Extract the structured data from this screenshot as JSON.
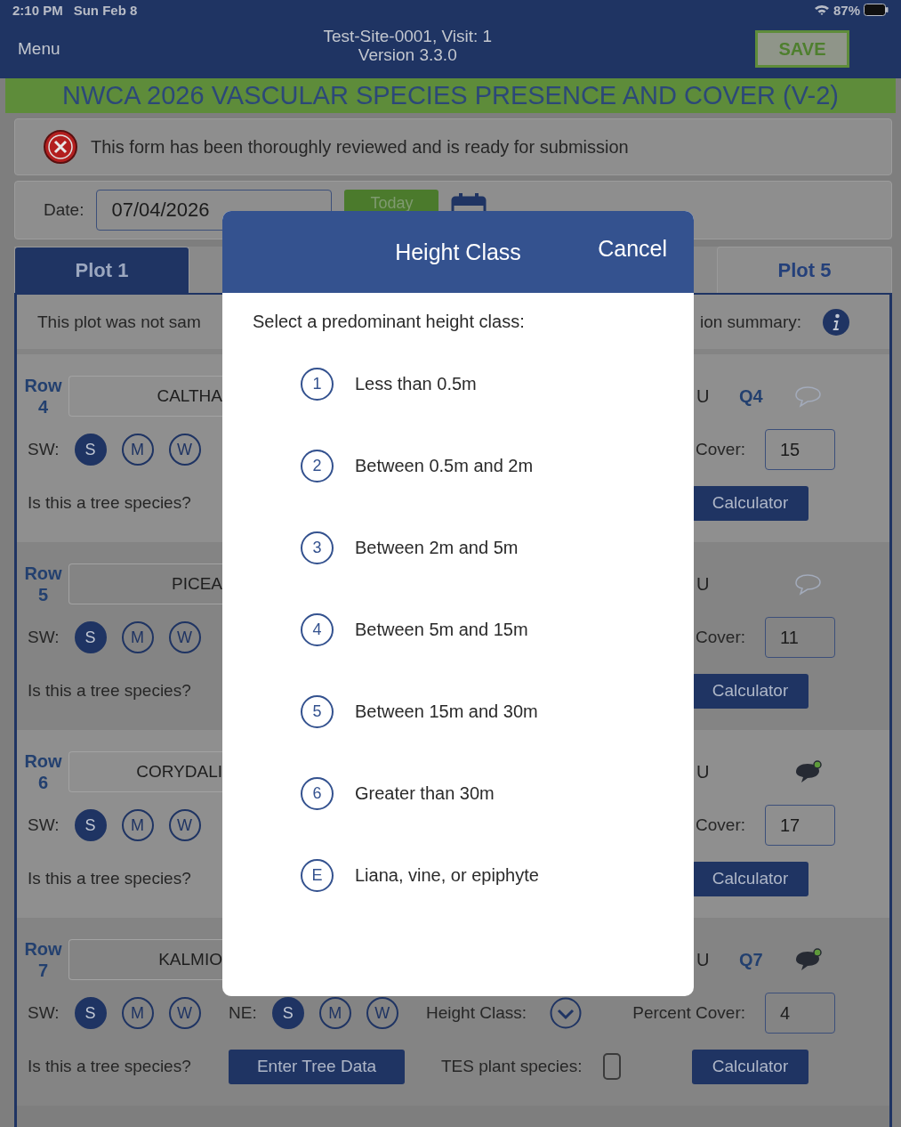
{
  "status_bar": {
    "time": "2:10 PM",
    "date": "Sun Feb 8",
    "battery": "87%"
  },
  "header": {
    "menu": "Menu",
    "title": "Test-Site-0001, Visit: 1",
    "version": "Version 3.3.0",
    "save": "SAVE"
  },
  "form_title": "NWCA 2026 VASCULAR SPECIES PRESENCE AND COVER (V-2)",
  "review": {
    "reviewed": false,
    "text": "This form has been thoroughly reviewed and is ready for submission"
  },
  "date": {
    "label": "Date:",
    "value": "07/04/2026",
    "today": "Today"
  },
  "tabs": [
    {
      "label": "Plot 1",
      "selected": true
    },
    {
      "label": "Plot 5",
      "selected": false
    }
  ],
  "plot_note": {
    "left": "This plot was not sam",
    "right": "ion summary:"
  },
  "rows": [
    {
      "label": "Row",
      "number": "4",
      "species": "CALTHA",
      "unknown": "U",
      "quadrant": "Q4",
      "has_comment": false,
      "sw": {
        "label": "SW:",
        "options": [
          {
            "label": "S",
            "selected": true
          },
          {
            "label": "M",
            "selected": false
          },
          {
            "label": "W",
            "selected": false
          }
        ]
      },
      "question": "Is this a tree species?",
      "cover_label": "Cover:",
      "cover": "15",
      "calculator": "Calculator"
    },
    {
      "label": "Row",
      "number": "5",
      "species": "PICEA",
      "unknown": "U",
      "has_comment": false,
      "sw": {
        "label": "SW:",
        "options": [
          {
            "label": "S",
            "selected": true
          },
          {
            "label": "M",
            "selected": false
          },
          {
            "label": "W",
            "selected": false
          }
        ]
      },
      "question": "Is this a tree species?",
      "cover_label": "Cover:",
      "cover": "11",
      "calculator": "Calculator"
    },
    {
      "label": "Row",
      "number": "6",
      "species": "CORYDALI",
      "unknown": "U",
      "has_comment": true,
      "sw": {
        "label": "SW:",
        "options": [
          {
            "label": "S",
            "selected": true
          },
          {
            "label": "M",
            "selected": false
          },
          {
            "label": "W",
            "selected": false
          }
        ]
      },
      "question": "Is this a tree species?",
      "cover_label": "Cover:",
      "cover": "17",
      "calculator": "Calculator"
    },
    {
      "label": "Row",
      "number": "7",
      "species": "KALMIO",
      "unknown": "U",
      "quadrant": "Q7",
      "has_comment": true,
      "sw": {
        "label": "SW:",
        "options": [
          {
            "label": "S",
            "selected": true
          },
          {
            "label": "M",
            "selected": false
          },
          {
            "label": "W",
            "selected": false
          }
        ]
      },
      "ne": {
        "label": "NE:",
        "options": [
          {
            "label": "S",
            "selected": true
          },
          {
            "label": "M",
            "selected": false
          },
          {
            "label": "W",
            "selected": false
          }
        ]
      },
      "height_class_label": "Height Class:",
      "question": "Is this a tree species?",
      "tree_button": "Enter Tree Data",
      "tes": {
        "label": "TES plant species:",
        "checked": false
      },
      "cover_label": "Percent Cover:",
      "cover": "4",
      "calculator": "Calculator"
    }
  ],
  "modal": {
    "title": "Height Class",
    "cancel": "Cancel",
    "prompt": "Select a predominant height class:",
    "options": [
      {
        "key": "1",
        "label": "Less than 0.5m"
      },
      {
        "key": "2",
        "label": "Between 0.5m and 2m"
      },
      {
        "key": "3",
        "label": "Between 2m and 5m"
      },
      {
        "key": "4",
        "label": "Between 5m and 15m"
      },
      {
        "key": "5",
        "label": "Between 15m and 30m"
      },
      {
        "key": "6",
        "label": "Greater than 30m"
      },
      {
        "key": "E",
        "label": "Liana, vine, or epiphyte"
      }
    ]
  }
}
